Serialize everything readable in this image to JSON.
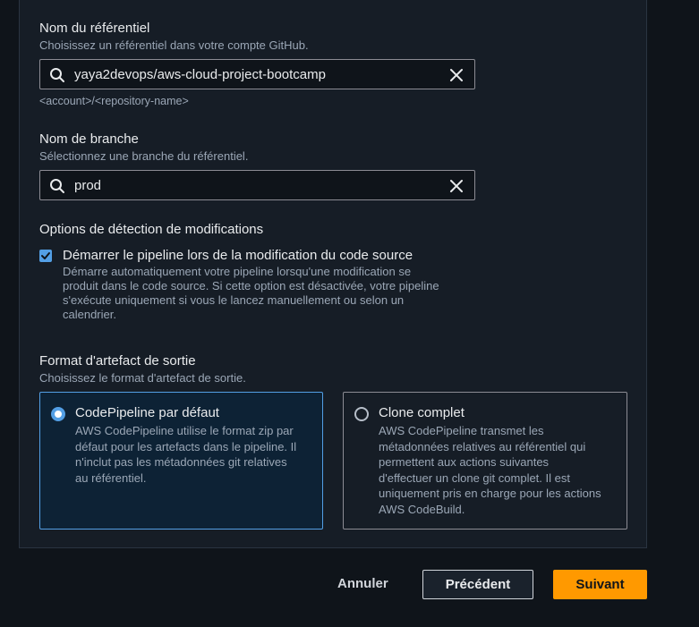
{
  "repository": {
    "label": "Nom du référentiel",
    "description": "Choisissez un référentiel dans votre compte GitHub.",
    "value": "yaya2devops/aws-cloud-project-bootcamp",
    "constraint": "<account>/<repository-name>"
  },
  "branch": {
    "label": "Nom de branche",
    "description": "Sélectionnez une branche du référentiel.",
    "value": "prod"
  },
  "change_detection": {
    "label": "Options de détection de modifications",
    "checkbox_label": "Démarrer le pipeline lors de la modification du code source",
    "checkbox_checked": true,
    "checkbox_description_lines": [
      "Démarre automatiquement votre pipeline lorsqu'une modification se",
      "produit dans le code source. Si cette option est désactivée, votre pipeline",
      "s'exécute uniquement si vous le lancez manuellement ou selon un",
      "calendrier."
    ]
  },
  "artifact_format": {
    "label": "Format d'artefact de sortie",
    "description": "Choisissez le format d'artefact de sortie.",
    "options": [
      {
        "title": "CodePipeline par défaut",
        "selected": true,
        "description_lines": [
          "AWS CodePipeline utilise le format zip par",
          "défaut pour les artefacts dans le pipeline. Il",
          "n'inclut pas les métadonnées git relatives",
          "au référentiel."
        ]
      },
      {
        "title": "Clone complet",
        "selected": false,
        "description_lines": [
          "AWS CodePipeline transmet les",
          "métadonnées relatives au référentiel qui",
          "permettent aux actions suivantes",
          "d'effectuer un clone git complet. Il est",
          "uniquement pris en charge pour les actions",
          "AWS CodeBuild."
        ]
      }
    ]
  },
  "footer": {
    "cancel_label": "Annuler",
    "previous_label": "Précédent",
    "next_label": "Suivant"
  },
  "colors": {
    "accent": "#539fe5",
    "primary_button": "#ff9900",
    "background": "#0f141a",
    "panel": "#161d26"
  }
}
